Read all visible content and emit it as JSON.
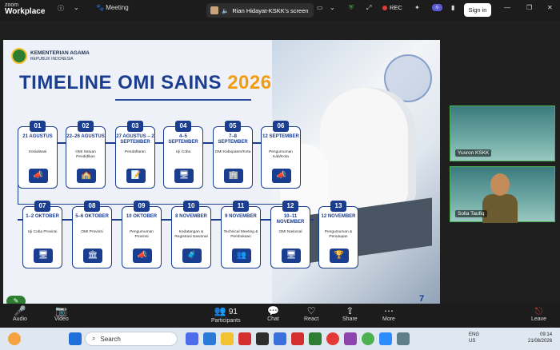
{
  "window": {
    "brand_line1": "zoom",
    "brand_line2": "Workplace",
    "meeting_label": "Meeting",
    "share_label": "Rian Hidayat-KSKK's screen",
    "rec_label": "REC",
    "signin_label": "Sign in"
  },
  "slide": {
    "org_name": "KEMENTERIAN AGAMA",
    "org_sub": "REPUBLIK INDONESIA",
    "title_main": "TIMELINE OMI SAINS",
    "title_year": "2026",
    "page_number": "7",
    "cards": [
      {
        "num": "01",
        "date": "21 AGUSTUS",
        "label": "Sosialisasi",
        "icon": "megaphone-icon",
        "glyph": "📣"
      },
      {
        "num": "02",
        "date": "22–26 AGUSTUS",
        "label": "OMI Satuan Pendidikan",
        "icon": "school-icon",
        "glyph": "🏫"
      },
      {
        "num": "03",
        "date": "27 AGUSTUS – 2 SEPTEMBER",
        "label": "Pendaftaran",
        "icon": "form-icon",
        "glyph": "📝"
      },
      {
        "num": "04",
        "date": "4–5 SEPTEMBER",
        "label": "Uji Coba",
        "icon": "monitor-icon",
        "glyph": "🖥"
      },
      {
        "num": "05",
        "date": "7–8 SEPTEMBER",
        "label": "OMI Kabupaten/Kota",
        "icon": "building-icon",
        "glyph": "🏢"
      },
      {
        "num": "06",
        "date": "12 SEPTEMBER",
        "label": "Pengumuman Kab/Kota",
        "icon": "megaphone-icon",
        "glyph": "📣"
      },
      {
        "num": "07",
        "date": "1–2 OKTOBER",
        "label": "Uji Coba Provinsi",
        "icon": "monitor-icon",
        "glyph": "🖥"
      },
      {
        "num": "08",
        "date": "5–6 OKTOBER",
        "label": "OMI Provinsi",
        "icon": "government-icon",
        "glyph": "🏛"
      },
      {
        "num": "09",
        "date": "10 OKTOBER",
        "label": "Pengumuman Provinsi",
        "icon": "megaphone-icon",
        "glyph": "📣"
      },
      {
        "num": "10",
        "date": "8 NOVEMBER",
        "label": "Kedatangan & Registrasi Nasional",
        "icon": "luggage-icon",
        "glyph": "🧳"
      },
      {
        "num": "11",
        "date": "9 NOVEMBER",
        "label": "Technical Meeting & Pembukaan",
        "icon": "meeting-icon",
        "glyph": "👥"
      },
      {
        "num": "12",
        "date": "10–11 NOVEMBER",
        "label": "OMI Nasional",
        "icon": "monitor-icon",
        "glyph": "🖥"
      },
      {
        "num": "13",
        "date": "12 NOVEMBER",
        "label": "Pengumuman & Penutupan",
        "icon": "trophy-icon",
        "glyph": "🏆"
      }
    ]
  },
  "participants_panel": [
    {
      "name": "Yusron KSKK"
    },
    {
      "name": "Solla Taufiq"
    }
  ],
  "controls": {
    "audio": "Audio",
    "video": "Video",
    "participants": "Participants",
    "participants_count": "91",
    "chat": "Chat",
    "react": "React",
    "share": "Share",
    "more": "More",
    "leave": "Leave"
  },
  "taskbar": {
    "search_placeholder": "Search",
    "lang1": "ENG",
    "lang2": "US",
    "time": "09:14",
    "date": "21/08/2026"
  },
  "colors": {
    "accent": "#1a3d8f",
    "year": "#f39c12",
    "leave": "#e53935"
  }
}
